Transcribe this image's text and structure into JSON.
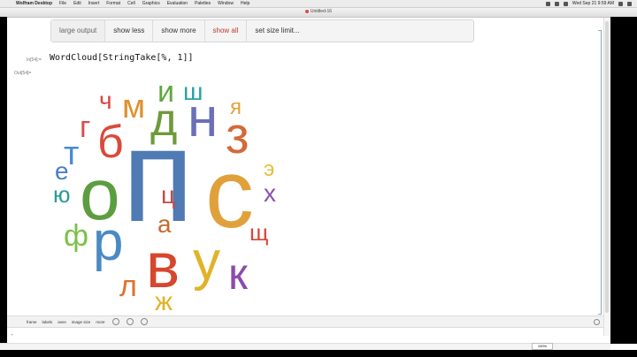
{
  "menubar": {
    "app": "Wolfram Desktop",
    "items": [
      "File",
      "Edit",
      "Insert",
      "Format",
      "Cell",
      "Graphics",
      "Evaluation",
      "Palettes",
      "Window",
      "Help"
    ],
    "clock": "Wed Sep 21  9:59 AM"
  },
  "window": {
    "title": "Untitled-16"
  },
  "suggestions": [
    "large output",
    "show less",
    "show more",
    "show all",
    "set size limit..."
  ],
  "cell": {
    "in_label": "In[54]:=",
    "input": "WordCloud[StringTake[%, 1]]",
    "out_label": "Out[54]="
  },
  "wordcloud": [
    {
      "text": "п",
      "color": "#4f7ab3"
    },
    {
      "text": "с",
      "color": "#e0a13b"
    },
    {
      "text": "о",
      "color": "#5c9e3f"
    },
    {
      "text": "в",
      "color": "#d6472d"
    },
    {
      "text": "д",
      "color": "#6f9a3a"
    },
    {
      "text": "н",
      "color": "#6a6fb8"
    },
    {
      "text": "и",
      "color": "#5ea83e"
    },
    {
      "text": "б",
      "color": "#d94a3a"
    },
    {
      "text": "з",
      "color": "#d4693a"
    },
    {
      "text": "м",
      "color": "#e08f2d"
    },
    {
      "text": "р",
      "color": "#4a8ac4"
    },
    {
      "text": "у",
      "color": "#e0b329"
    },
    {
      "text": "к",
      "color": "#8c4bb0"
    },
    {
      "text": "т",
      "color": "#4a8ad0"
    },
    {
      "text": "г",
      "color": "#d94f4f"
    },
    {
      "text": "ч",
      "color": "#d94540"
    },
    {
      "text": "ш",
      "color": "#2aa3a3"
    },
    {
      "text": "я",
      "color": "#e2a43a"
    },
    {
      "text": "е",
      "color": "#4a7fc4"
    },
    {
      "text": "ю",
      "color": "#2a9b9b"
    },
    {
      "text": "ф",
      "color": "#7bc14a"
    },
    {
      "text": "л",
      "color": "#e0722d"
    },
    {
      "text": "ж",
      "color": "#e0b329"
    },
    {
      "text": "ц",
      "color": "#c44a4a"
    },
    {
      "text": "а",
      "color": "#c46a2d"
    },
    {
      "text": "э",
      "color": "#e6c03a"
    },
    {
      "text": "х",
      "color": "#8a4fb3"
    },
    {
      "text": "щ",
      "color": "#d9453a"
    }
  ],
  "bottom_toolbar": [
    "frame",
    "labels",
    "axes",
    "image size",
    "more"
  ],
  "zoom": "100%"
}
